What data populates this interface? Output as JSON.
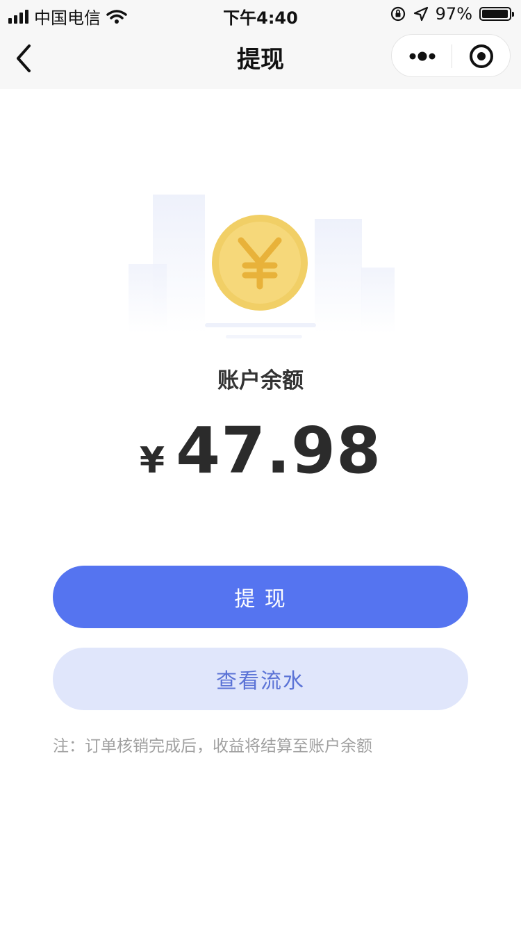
{
  "status_bar": {
    "carrier": "中国电信",
    "time": "下午4:40",
    "battery_percent": "97%",
    "battery_level": 0.97
  },
  "nav": {
    "title": "提现",
    "back_icon": "chevron-left-icon",
    "more_icon": "more-dots-icon",
    "close_icon": "target-circle-icon"
  },
  "balance": {
    "label": "账户余额",
    "currency": "¥",
    "amount": "47.98"
  },
  "actions": {
    "withdraw_label": "提 现",
    "flow_label": "查看流水"
  },
  "note": "注：订单核销完成后，收益将结算至账户余额",
  "colors": {
    "primary": "#5574f0",
    "secondary_bg": "#e0e6fb",
    "secondary_text": "#5b73d6",
    "coin_outer": "#f1cf66",
    "coin_inner": "#f6d87a",
    "coin_symbol": "#e8b23a"
  }
}
